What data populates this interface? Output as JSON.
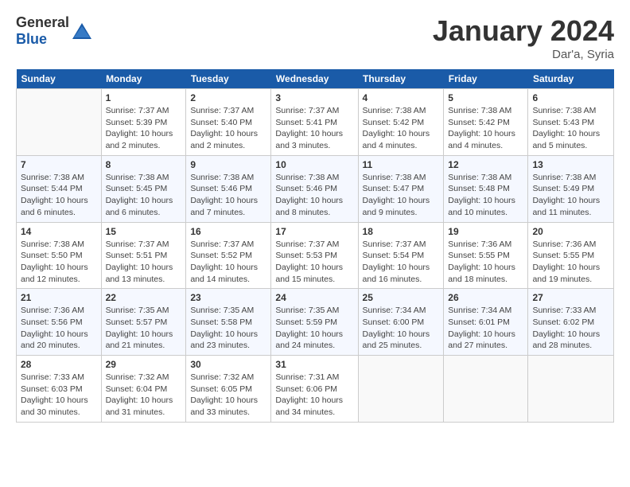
{
  "logo": {
    "general": "General",
    "blue": "Blue"
  },
  "header": {
    "month": "January 2024",
    "location": "Dar'a, Syria"
  },
  "columns": [
    "Sunday",
    "Monday",
    "Tuesday",
    "Wednesday",
    "Thursday",
    "Friday",
    "Saturday"
  ],
  "weeks": [
    [
      {
        "day": "",
        "info": ""
      },
      {
        "day": "1",
        "info": "Sunrise: 7:37 AM\nSunset: 5:39 PM\nDaylight: 10 hours\nand 2 minutes."
      },
      {
        "day": "2",
        "info": "Sunrise: 7:37 AM\nSunset: 5:40 PM\nDaylight: 10 hours\nand 2 minutes."
      },
      {
        "day": "3",
        "info": "Sunrise: 7:37 AM\nSunset: 5:41 PM\nDaylight: 10 hours\nand 3 minutes."
      },
      {
        "day": "4",
        "info": "Sunrise: 7:38 AM\nSunset: 5:42 PM\nDaylight: 10 hours\nand 4 minutes."
      },
      {
        "day": "5",
        "info": "Sunrise: 7:38 AM\nSunset: 5:42 PM\nDaylight: 10 hours\nand 4 minutes."
      },
      {
        "day": "6",
        "info": "Sunrise: 7:38 AM\nSunset: 5:43 PM\nDaylight: 10 hours\nand 5 minutes."
      }
    ],
    [
      {
        "day": "7",
        "info": "Sunrise: 7:38 AM\nSunset: 5:44 PM\nDaylight: 10 hours\nand 6 minutes."
      },
      {
        "day": "8",
        "info": "Sunrise: 7:38 AM\nSunset: 5:45 PM\nDaylight: 10 hours\nand 6 minutes."
      },
      {
        "day": "9",
        "info": "Sunrise: 7:38 AM\nSunset: 5:46 PM\nDaylight: 10 hours\nand 7 minutes."
      },
      {
        "day": "10",
        "info": "Sunrise: 7:38 AM\nSunset: 5:46 PM\nDaylight: 10 hours\nand 8 minutes."
      },
      {
        "day": "11",
        "info": "Sunrise: 7:38 AM\nSunset: 5:47 PM\nDaylight: 10 hours\nand 9 minutes."
      },
      {
        "day": "12",
        "info": "Sunrise: 7:38 AM\nSunset: 5:48 PM\nDaylight: 10 hours\nand 10 minutes."
      },
      {
        "day": "13",
        "info": "Sunrise: 7:38 AM\nSunset: 5:49 PM\nDaylight: 10 hours\nand 11 minutes."
      }
    ],
    [
      {
        "day": "14",
        "info": "Sunrise: 7:38 AM\nSunset: 5:50 PM\nDaylight: 10 hours\nand 12 minutes."
      },
      {
        "day": "15",
        "info": "Sunrise: 7:37 AM\nSunset: 5:51 PM\nDaylight: 10 hours\nand 13 minutes."
      },
      {
        "day": "16",
        "info": "Sunrise: 7:37 AM\nSunset: 5:52 PM\nDaylight: 10 hours\nand 14 minutes."
      },
      {
        "day": "17",
        "info": "Sunrise: 7:37 AM\nSunset: 5:53 PM\nDaylight: 10 hours\nand 15 minutes."
      },
      {
        "day": "18",
        "info": "Sunrise: 7:37 AM\nSunset: 5:54 PM\nDaylight: 10 hours\nand 16 minutes."
      },
      {
        "day": "19",
        "info": "Sunrise: 7:36 AM\nSunset: 5:55 PM\nDaylight: 10 hours\nand 18 minutes."
      },
      {
        "day": "20",
        "info": "Sunrise: 7:36 AM\nSunset: 5:55 PM\nDaylight: 10 hours\nand 19 minutes."
      }
    ],
    [
      {
        "day": "21",
        "info": "Sunrise: 7:36 AM\nSunset: 5:56 PM\nDaylight: 10 hours\nand 20 minutes."
      },
      {
        "day": "22",
        "info": "Sunrise: 7:35 AM\nSunset: 5:57 PM\nDaylight: 10 hours\nand 21 minutes."
      },
      {
        "day": "23",
        "info": "Sunrise: 7:35 AM\nSunset: 5:58 PM\nDaylight: 10 hours\nand 23 minutes."
      },
      {
        "day": "24",
        "info": "Sunrise: 7:35 AM\nSunset: 5:59 PM\nDaylight: 10 hours\nand 24 minutes."
      },
      {
        "day": "25",
        "info": "Sunrise: 7:34 AM\nSunset: 6:00 PM\nDaylight: 10 hours\nand 25 minutes."
      },
      {
        "day": "26",
        "info": "Sunrise: 7:34 AM\nSunset: 6:01 PM\nDaylight: 10 hours\nand 27 minutes."
      },
      {
        "day": "27",
        "info": "Sunrise: 7:33 AM\nSunset: 6:02 PM\nDaylight: 10 hours\nand 28 minutes."
      }
    ],
    [
      {
        "day": "28",
        "info": "Sunrise: 7:33 AM\nSunset: 6:03 PM\nDaylight: 10 hours\nand 30 minutes."
      },
      {
        "day": "29",
        "info": "Sunrise: 7:32 AM\nSunset: 6:04 PM\nDaylight: 10 hours\nand 31 minutes."
      },
      {
        "day": "30",
        "info": "Sunrise: 7:32 AM\nSunset: 6:05 PM\nDaylight: 10 hours\nand 33 minutes."
      },
      {
        "day": "31",
        "info": "Sunrise: 7:31 AM\nSunset: 6:06 PM\nDaylight: 10 hours\nand 34 minutes."
      },
      {
        "day": "",
        "info": ""
      },
      {
        "day": "",
        "info": ""
      },
      {
        "day": "",
        "info": ""
      }
    ]
  ]
}
